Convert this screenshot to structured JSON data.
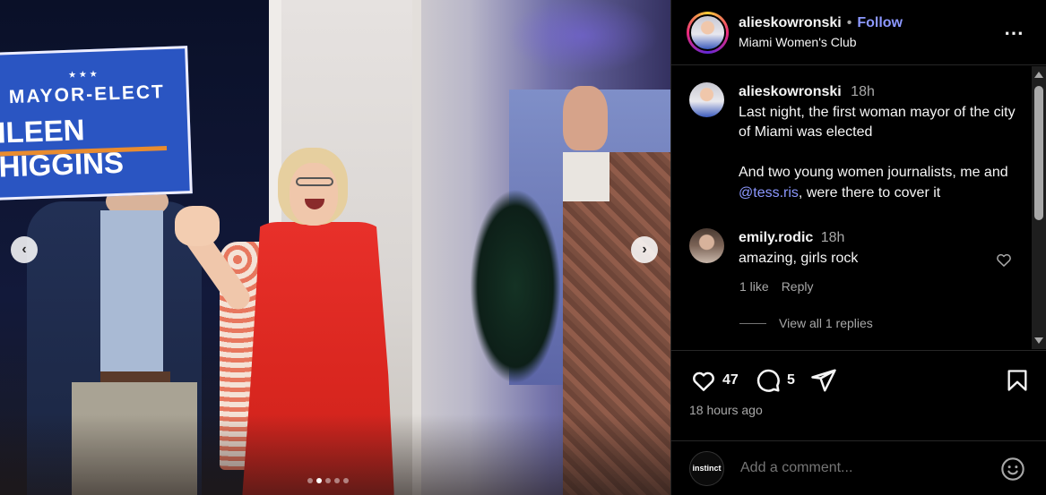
{
  "header": {
    "username": "alieskowronski",
    "separator": "•",
    "follow_label": "Follow",
    "location": "Miami Women's Club",
    "more_icon": "⋯"
  },
  "photo": {
    "sign_line1": "MAYOR-ELECT",
    "sign_line2": "ILEEN HIGGINS",
    "prev_icon": "‹",
    "next_icon": "›",
    "carousel_total": 5,
    "carousel_active": 2
  },
  "caption": {
    "username": "alieskowronski",
    "time": "18h",
    "text_before_mention": "Last night, the first woman mayor of the city of Miami was elected\n\nAnd two young women journalists, me and ",
    "mention": "@tess.ris",
    "text_after_mention": ", were there to cover it"
  },
  "comment": {
    "username": "emily.rodic",
    "time": "18h",
    "text": "amazing, girls rock",
    "likes_label": "1 like",
    "reply_label": "Reply",
    "view_replies_label": "View all 1 replies"
  },
  "actions": {
    "likes": "47",
    "comments": "5",
    "posted": "18 hours ago"
  },
  "add_comment": {
    "avatar_text": "instinct",
    "placeholder": "Add a comment..."
  },
  "colors": {
    "link": "#8c98ff",
    "muted": "#a8a8a8",
    "background": "#000000"
  }
}
